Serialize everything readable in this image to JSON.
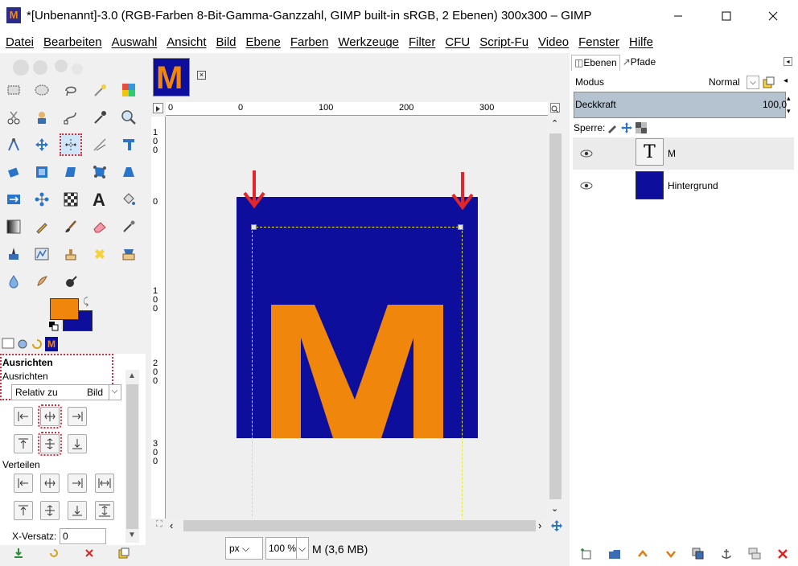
{
  "window": {
    "title": "*[Unbenannt]-3.0 (RGB-Farben 8-Bit-Gamma-Ganzzahl, GIMP built-in sRGB, 2 Ebenen) 300x300 – GIMP",
    "app_icon_letter": "M"
  },
  "menu": [
    "Datei",
    "Bearbeiten",
    "Auswahl",
    "Ansicht",
    "Bild",
    "Ebene",
    "Farben",
    "Werkzeuge",
    "Filter",
    "CFU",
    "Script-Fu",
    "Video",
    "Fenster",
    "Hilfe"
  ],
  "colors": {
    "foreground": "#f1860c",
    "background": "#0e0e9c",
    "accent_highlight": "#e2263a"
  },
  "align_panel": {
    "title": "Ausrichten",
    "subtitle": "Ausrichten",
    "relative_label": "Relativ zu",
    "relative_value": "Bild",
    "distribute_label": "Verteilen",
    "xoffset_label": "X-Versatz:",
    "xoffset_value": "0"
  },
  "image_tab": {
    "thumb_letter": "M"
  },
  "rulers": {
    "horizontal": [
      "0",
      "0",
      "100",
      "200",
      "300"
    ],
    "vertical": [
      "1\n0\n0",
      "0",
      "1\n0\n0",
      "2\n0\n0",
      "3\n0\n0"
    ]
  },
  "canvas": {
    "letter": "M"
  },
  "statusbar": {
    "unit": "px",
    "zoom": "100 %",
    "info": "M (3,6 MB)"
  },
  "layers_panel": {
    "tabs": [
      "Ebenen",
      "Pfade"
    ],
    "mode_label": "Modus",
    "mode_value": "Normal",
    "opacity_label": "Deckkraft",
    "opacity_value": "100,0",
    "lock_label": "Sperre:",
    "layers": [
      {
        "name": "M",
        "thumb": "T"
      },
      {
        "name": "Hintergrund"
      }
    ]
  },
  "icons": [
    "rect-select-icon",
    "ellipse-select-icon",
    "lasso-icon",
    "fuzzy-select-icon",
    "color-select-icon",
    "scissors-icon",
    "foreground-select-icon",
    "paths-icon",
    "color-picker-icon",
    "zoom-icon",
    "measure-icon",
    "move-icon",
    "align-icon",
    "crop-icon",
    "transform-icon",
    "text-icon",
    "paintbrush-icon",
    "eraser-icon",
    "eye-icon"
  ]
}
